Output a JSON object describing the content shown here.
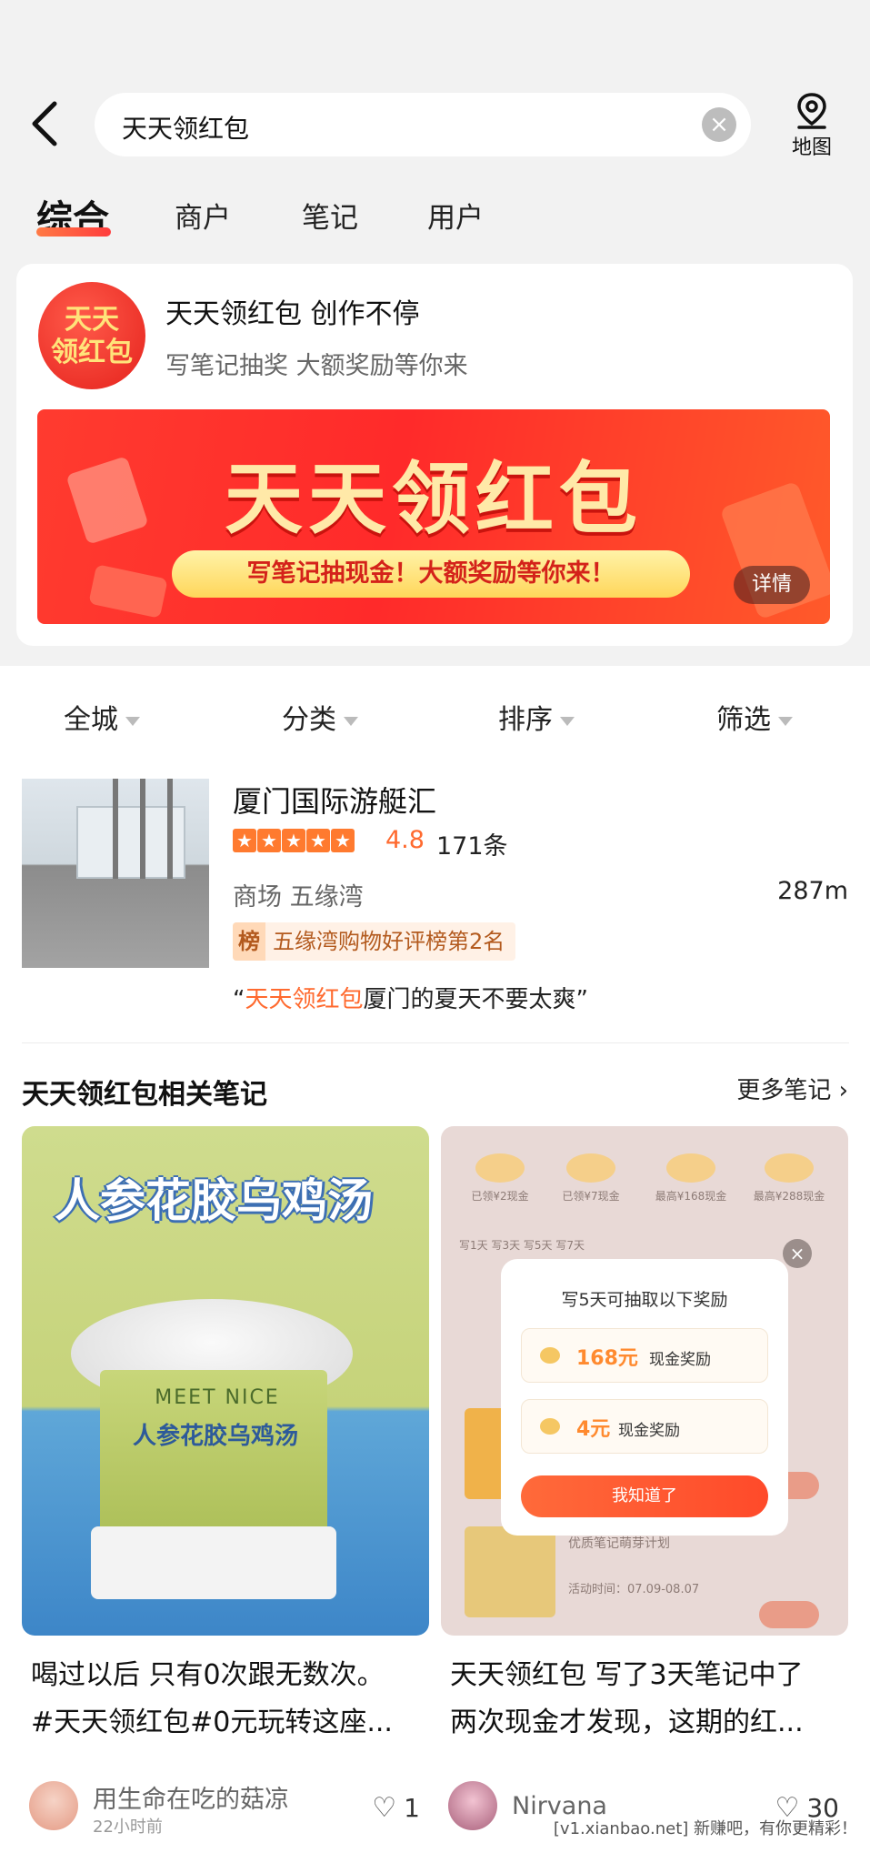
{
  "search": {
    "query": "天天领红包",
    "map_label": "地图"
  },
  "tabs": [
    {
      "label": "综合",
      "active": true
    },
    {
      "label": "商户"
    },
    {
      "label": "笔记"
    },
    {
      "label": "用户"
    }
  ],
  "promo": {
    "logo_text": "天天领红包",
    "title": "天天领红包 创作不停",
    "subtitle": "写笔记抽奖 大额奖励等你来",
    "banner_title": "天天领红包",
    "banner_pill": "写笔记抽现金！大额奖励等你来！",
    "detail_label": "详情"
  },
  "filters": [
    "全城",
    "分类",
    "排序",
    "筛选"
  ],
  "shop": {
    "name": "厦门国际游艇汇",
    "rating": "4.8",
    "reviews": "171条",
    "category": "商场 五缘湾",
    "distance": "287m",
    "rank_tag": "榜",
    "rank_text": "五缘湾购物好评榜第2名",
    "quote_open": "“",
    "quote_highlight": "天天领红包",
    "quote_text": "厦门的夏天不要太爽",
    "quote_close": "”"
  },
  "notes_section": {
    "title": "天天领红包相关笔记",
    "more_label": "更多笔记"
  },
  "notes": [
    {
      "image_title": "人参花胶乌鸡汤",
      "jar_brand": "MEET NICE",
      "jar_label": "人参花胶乌鸡汤",
      "title_line1": "喝过以后 只有0次跟无数次。",
      "title_line2": "#天天领红包#0元玩转这座...",
      "author": "用生命在吃的菇凉",
      "time": "22小时前",
      "likes": "1"
    },
    {
      "dialog_title": "写5天可抽取以下奖励",
      "reward1_amount": "168元",
      "reward1_desc": "现金奖励",
      "reward2_amount": "4元",
      "reward2_desc": "现金奖励",
      "dialog_button": "我知道了",
      "row_labels": [
        "已领¥2现金",
        "已领¥7现金",
        "最高¥168现金",
        "最高¥288现金"
      ],
      "day_labels": "写1天        写3天        写5天        写7天",
      "side_line1": "优质笔记萌芽计划",
      "side_line2": "活动时间：07.09-08.07",
      "title_line1": "天天领红包 写了3天笔记中了",
      "title_line2": "两次现金才发现，这期的红...",
      "author": "Nirvana",
      "likes": "30"
    }
  ],
  "watermark": "[v1.xianbao.net] 新赚吧，有你更精彩！"
}
